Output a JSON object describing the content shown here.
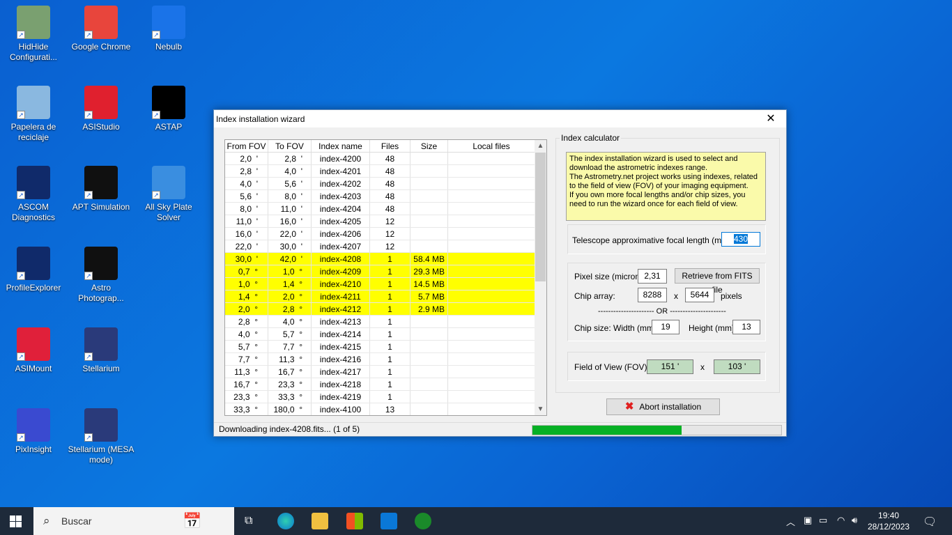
{
  "desktop": {
    "icons": [
      {
        "label": "HidHide Configurati...",
        "color": "#7aa070",
        "col": 0,
        "row": 0
      },
      {
        "label": "Google Chrome",
        "color": "#e8453c",
        "col": 1,
        "row": 0
      },
      {
        "label": "Nebulb",
        "color": "#1a73e8",
        "col": 2,
        "row": 0
      },
      {
        "label": "Papelera de reciclaje",
        "color": "#8ab8e0",
        "col": 0,
        "row": 1
      },
      {
        "label": "ASIStudio",
        "color": "#e0202e",
        "col": 1,
        "row": 1
      },
      {
        "label": "ASTAP",
        "color": "#000000",
        "col": 2,
        "row": 1
      },
      {
        "label": "ASCOM Diagnostics",
        "color": "#102a6a",
        "col": 0,
        "row": 2
      },
      {
        "label": "APT Simulation",
        "color": "#101010",
        "col": 1,
        "row": 2
      },
      {
        "label": "All Sky Plate Solver",
        "color": "#3a8ee0",
        "col": 2,
        "row": 2
      },
      {
        "label": "ProfileExplorer",
        "color": "#102a6a",
        "col": 0,
        "row": 3
      },
      {
        "label": "Astro Photograp...",
        "color": "#101010",
        "col": 1,
        "row": 3
      },
      {
        "label": "ASIMount",
        "color": "#e0203a",
        "col": 0,
        "row": 4
      },
      {
        "label": "Stellarium",
        "color": "#2a3a7a",
        "col": 1,
        "row": 4
      },
      {
        "label": "PixInsight",
        "color": "#3a4ad0",
        "col": 0,
        "row": 5
      },
      {
        "label": "Stellarium (MESA mode)",
        "color": "#2a3a7a",
        "col": 1,
        "row": 5
      }
    ]
  },
  "window": {
    "title": "Index installation wizard",
    "close": "✕"
  },
  "table": {
    "headers": [
      "From FOV",
      "To FOV",
      "Index name",
      "Files",
      "Size",
      "Local files"
    ],
    "rows": [
      [
        "2,0  '",
        "2,8  '",
        "index-4200",
        "48",
        "",
        "",
        false
      ],
      [
        "2,8  '",
        "4,0  '",
        "index-4201",
        "48",
        "",
        "",
        false
      ],
      [
        "4,0  '",
        "5,6  '",
        "index-4202",
        "48",
        "",
        "",
        false
      ],
      [
        "5,6  '",
        "8,0  '",
        "index-4203",
        "48",
        "",
        "",
        false
      ],
      [
        "8,0  '",
        "11,0  '",
        "index-4204",
        "48",
        "",
        "",
        false
      ],
      [
        "11,0  '",
        "16,0  '",
        "index-4205",
        "12",
        "",
        "",
        false
      ],
      [
        "16,0  '",
        "22,0  '",
        "index-4206",
        "12",
        "",
        "",
        false
      ],
      [
        "22,0  '",
        "30,0  '",
        "index-4207",
        "12",
        "",
        "",
        false
      ],
      [
        "30,0  '",
        "42,0  '",
        "index-4208",
        "1",
        "58.4 MB",
        "",
        true
      ],
      [
        "0,7  °",
        "1,0  °",
        "index-4209",
        "1",
        "29.3 MB",
        "",
        true
      ],
      [
        "1,0  °",
        "1,4  °",
        "index-4210",
        "1",
        "14.5 MB",
        "",
        true
      ],
      [
        "1,4  °",
        "2,0  °",
        "index-4211",
        "1",
        "5.7 MB",
        "",
        true
      ],
      [
        "2,0  °",
        "2,8  °",
        "index-4212",
        "1",
        "2.9 MB",
        "",
        true
      ],
      [
        "2,8  °",
        "4,0  °",
        "index-4213",
        "1",
        "",
        "",
        false
      ],
      [
        "4,0  °",
        "5,7  °",
        "index-4214",
        "1",
        "",
        "",
        false
      ],
      [
        "5,7  °",
        "7,7  °",
        "index-4215",
        "1",
        "",
        "",
        false
      ],
      [
        "7,7  °",
        "11,3  °",
        "index-4216",
        "1",
        "",
        "",
        false
      ],
      [
        "11,3  °",
        "16,7  °",
        "index-4217",
        "1",
        "",
        "",
        false
      ],
      [
        "16,7  °",
        "23,3  °",
        "index-4218",
        "1",
        "",
        "",
        false
      ],
      [
        "23,3  °",
        "33,3  °",
        "index-4219",
        "1",
        "",
        "",
        false
      ],
      [
        "33,3  °",
        "180,0  °",
        "index-4100",
        "13",
        "",
        "",
        false
      ]
    ]
  },
  "calc": {
    "legend": "Index calculator",
    "info": "The index installation wizard is used to select and download the astrometric indexes range.\nThe Astrometry.net project works using indexes, related to the field of view (FOV) of your imaging equipment.\nIf you own more focal lengths and/or chip sizes, you need to run the wizard once for each field of view.",
    "focal_label": "Telescope approximative focal length (mm)",
    "focal_value": "430",
    "pixel_label": "Pixel size (micron)",
    "pixel_value": "2,31",
    "retrieve": "Retrieve from FITS file",
    "chip_label": "Chip array:",
    "chip_w": "8288",
    "x": "x",
    "chip_h": "5644",
    "pixels": "pixels",
    "or": "---------------------- OR ----------------------",
    "chipsize_label": "Chip size:  Width (mm)",
    "width_value": "19",
    "height_label": "Height (mm)",
    "height_value": "13",
    "fov_label": "Field of View  (FOV)",
    "fov_w": "151 '",
    "fov_h": "103 '"
  },
  "abort": "Abort installation",
  "status": {
    "text": "Downloading index-4208.fits... (1 of 5)",
    "progress_percent": 60
  },
  "taskbar": {
    "search": "Buscar",
    "time": "19:40",
    "date": "28/12/2023"
  }
}
